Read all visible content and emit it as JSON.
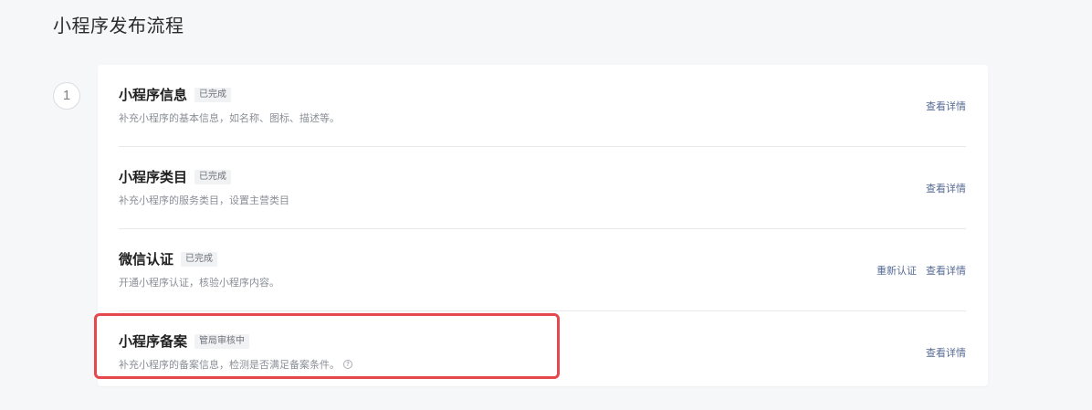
{
  "page": {
    "title": "小程序发布流程",
    "step_number": "1"
  },
  "items": [
    {
      "title": "小程序信息",
      "status": "已完成",
      "description": "补充小程序的基本信息，如名称、图标、描述等。",
      "actions": [
        "查看详情"
      ]
    },
    {
      "title": "小程序类目",
      "status": "已完成",
      "description": "补充小程序的服务类目，设置主营类目",
      "actions": [
        "查看详情"
      ]
    },
    {
      "title": "微信认证",
      "status": "已完成",
      "description": "开通小程序认证，核验小程序内容。",
      "actions": [
        "重新认证",
        "查看详情"
      ]
    },
    {
      "title": "小程序备案",
      "status": "管局审核中",
      "description": "补充小程序的备案信息，检测是否满足备案条件。",
      "help_icon": "question-circle",
      "actions": [
        "查看详情"
      ]
    }
  ],
  "colors": {
    "link": "#576b95",
    "highlight": "#e5484d"
  }
}
